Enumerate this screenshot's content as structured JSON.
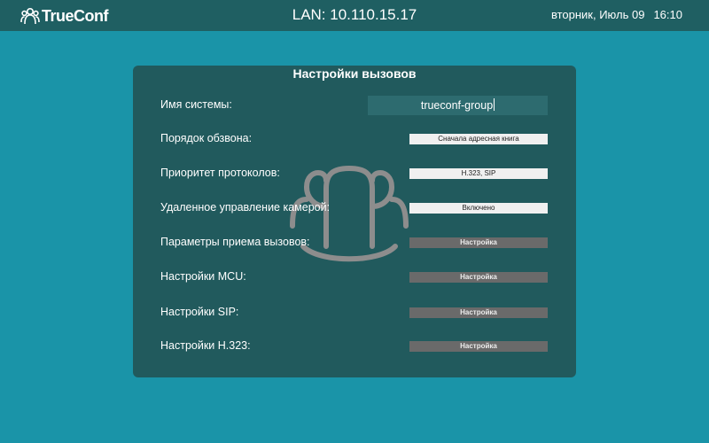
{
  "header": {
    "logo_text": "TrueConf",
    "network": "LAN: 10.110.15.17",
    "date": "вторник, Июль 09",
    "time": "16:10"
  },
  "panel": {
    "title": "Настройки вызовов",
    "system_name": {
      "label": "Имя системы:",
      "value": "trueconf-group"
    },
    "dial_order": {
      "label": "Порядок обзвона:",
      "value": "Сначала адресная книга"
    },
    "protocol_priority": {
      "label": "Приоритет протоколов:",
      "value": "H.323, SIP"
    },
    "camera_control": {
      "label": "Удаленное управление камерой:",
      "value": "Включено"
    },
    "incoming_calls": {
      "label": "Параметры приема вызовов:",
      "button": "Настройка"
    },
    "mcu": {
      "label": "Настройки MCU:",
      "button": "Настройка"
    },
    "sip": {
      "label": "Настройки SIP:",
      "button": "Настройка"
    },
    "h323": {
      "label": "Настройки H.323:",
      "button": "Настройка"
    }
  },
  "colors": {
    "background": "#1a94a8",
    "topbar": "#1f5f62",
    "panel": "#215a5d",
    "value_box": "#f0f0f0",
    "button": "#6a6a6a",
    "input": "#2d6b6f"
  },
  "icons": {
    "logo": "trueconf-logo-icon",
    "watermark": "group-users-icon"
  }
}
